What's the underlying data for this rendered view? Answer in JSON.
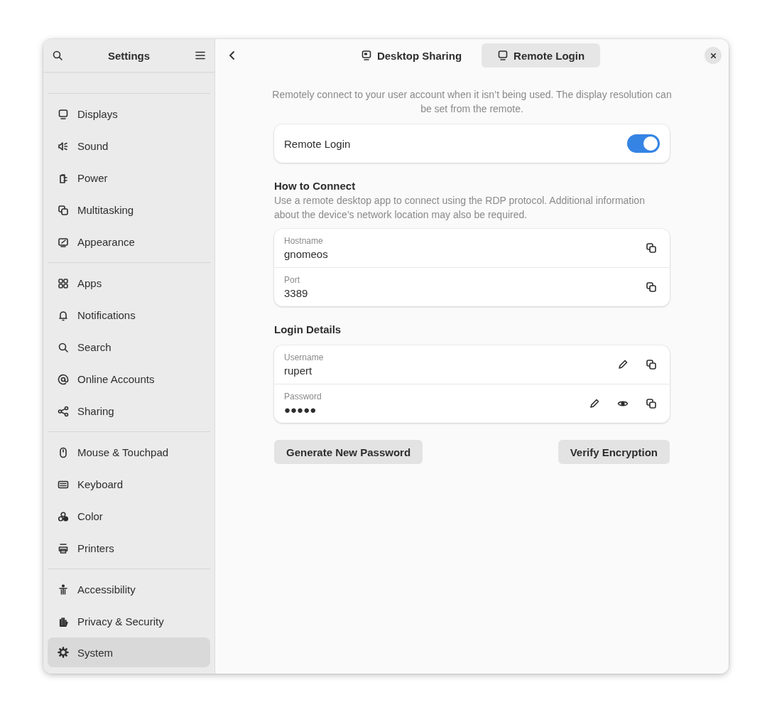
{
  "window": {
    "title": "Settings"
  },
  "sidebar": {
    "groups": [
      [
        {
          "label": "Displays",
          "selected": false
        },
        {
          "label": "Sound",
          "selected": false
        },
        {
          "label": "Power",
          "selected": false
        },
        {
          "label": "Multitasking",
          "selected": false
        },
        {
          "label": "Appearance",
          "selected": false
        }
      ],
      [
        {
          "label": "Apps",
          "selected": false
        },
        {
          "label": "Notifications",
          "selected": false
        },
        {
          "label": "Search",
          "selected": false
        },
        {
          "label": "Online Accounts",
          "selected": false
        },
        {
          "label": "Sharing",
          "selected": false
        }
      ],
      [
        {
          "label": "Mouse & Touchpad",
          "selected": false
        },
        {
          "label": "Keyboard",
          "selected": false
        },
        {
          "label": "Color",
          "selected": false
        },
        {
          "label": "Printers",
          "selected": false
        }
      ],
      [
        {
          "label": "Accessibility",
          "selected": false
        },
        {
          "label": "Privacy & Security",
          "selected": false
        },
        {
          "label": "System",
          "selected": true
        }
      ]
    ]
  },
  "tabs": [
    {
      "label": "Desktop Sharing",
      "selected": false
    },
    {
      "label": "Remote Login",
      "selected": true
    }
  ],
  "description": "Remotely connect to your user account when it isn’t being used. The display resolution can be set from the remote.",
  "remote_login": {
    "label": "Remote Login",
    "on": true
  },
  "how_to_connect": {
    "title": "How to Connect",
    "description": "Use a remote desktop app to connect using the RDP protocol. Additional information about the device’s network location may also be required.",
    "rows": [
      {
        "label": "Hostname",
        "value": "gnomeos",
        "actions": [
          {
            "kind": "copy"
          }
        ]
      },
      {
        "label": "Port",
        "value": "3389",
        "actions": [
          {
            "kind": "copy"
          }
        ]
      }
    ]
  },
  "login_details": {
    "title": "Login Details",
    "rows": [
      {
        "label": "Username",
        "value": "rupert",
        "actions": [
          {
            "kind": "edit"
          },
          {
            "kind": "copy"
          }
        ]
      },
      {
        "label": "Password",
        "value": "●●●●●",
        "actions": [
          {
            "kind": "edit"
          },
          {
            "kind": "reveal"
          },
          {
            "kind": "copy"
          }
        ]
      }
    ]
  },
  "buttons": [
    {
      "label": "Generate New Password"
    },
    {
      "label": "Verify Encryption"
    }
  ]
}
